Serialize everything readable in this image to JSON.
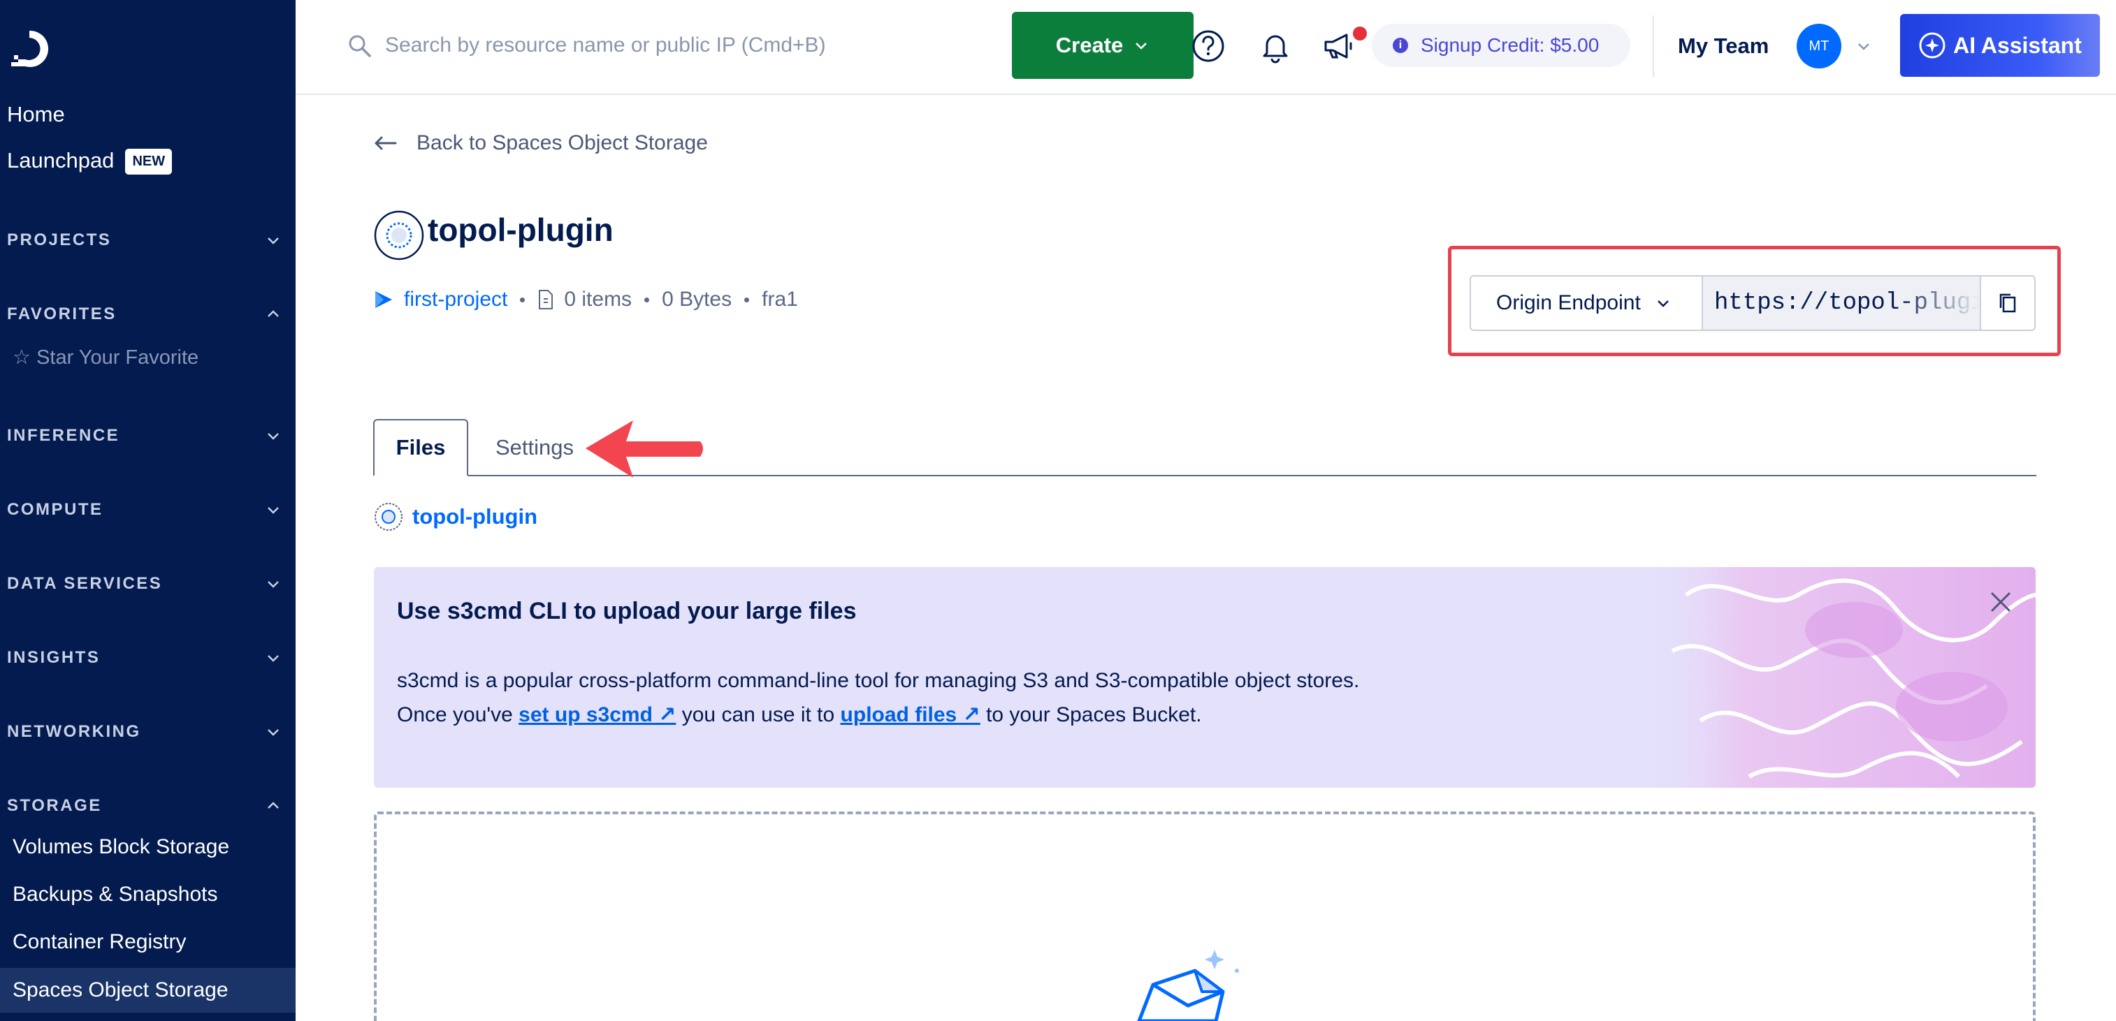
{
  "sidebar": {
    "home": "Home",
    "launchpad": "Launchpad",
    "launchpad_badge": "NEW",
    "sections": {
      "projects": "PROJECTS",
      "favorites": "FAVORITES",
      "inference": "INFERENCE",
      "compute": "COMPUTE",
      "data_services": "DATA SERVICES",
      "insights": "INSIGHTS",
      "networking": "NETWORKING",
      "storage": "STORAGE"
    },
    "favorites_item": "Star Your Favorite",
    "storage_items": [
      "Volumes Block Storage",
      "Backups & Snapshots",
      "Container Registry",
      "Spaces Object Storage"
    ]
  },
  "topbar": {
    "search_placeholder": "Search by resource name or public IP (Cmd+B)",
    "create_label": "Create",
    "credit_label": "Signup Credit: $5.00",
    "team_name": "My Team",
    "avatar_initials": "MT",
    "ai_label": "AI Assistant"
  },
  "main": {
    "back_label": "Back to Spaces Object Storage",
    "bucket_name": "topol-plugin",
    "meta": {
      "project": "first-project",
      "items": "0 items",
      "size": "0 Bytes",
      "region": "fra1"
    },
    "endpoint_select": "Origin Endpoint",
    "endpoint_url": "https://topol-plugin",
    "tabs": [
      "Files",
      "Settings"
    ],
    "breadcrumb": "topol-plugin",
    "banner": {
      "title": "Use s3cmd CLI to upload your large files",
      "line1": "s3cmd is a popular cross-platform command-line tool for managing S3 and S3-compatible object stores.",
      "line2_a": "Once you've",
      "link1": "set up s3cmd",
      "line2_b": "you can use it to",
      "link2": "upload files",
      "line2_c": "to your Spaces Bucket."
    }
  },
  "colors": {
    "sidebar_bg": "#031b4e",
    "create_green": "#0b7e3b",
    "link_blue": "#0069ff",
    "highlight_red": "#e8404e",
    "banner_bg": "#e4e1fb"
  }
}
